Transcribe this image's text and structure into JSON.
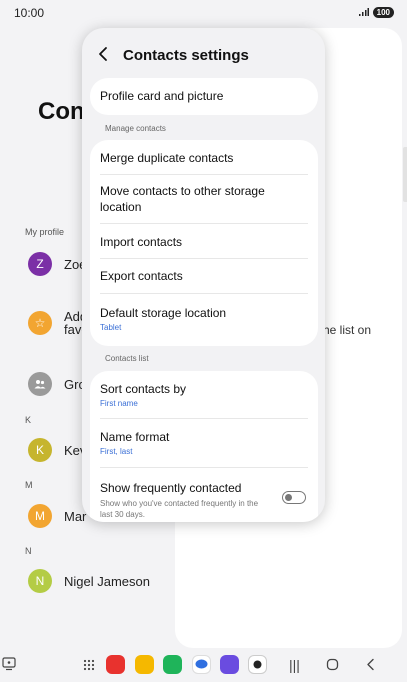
{
  "status_bar": {
    "time": "10:00",
    "battery": "100"
  },
  "background": {
    "title": "Con",
    "my_profile_label": "My profile",
    "rows": [
      {
        "initial": "Z",
        "name": "Zoe",
        "color": "#7b2fa6"
      },
      {
        "initial": "☆",
        "name": "Add",
        "name2": "fave",
        "color": "#f2a531"
      },
      {
        "initial": "",
        "name": "Gro",
        "color": "#9a9a9a"
      },
      {
        "initial": "K",
        "name": "Kev",
        "color": "#c6b52e"
      },
      {
        "initial": "M",
        "name": "Mar",
        "color": "#f2a531"
      },
      {
        "initial": "N",
        "name": "Nigel Jameson",
        "color": "#b4cc45"
      }
    ],
    "letters": {
      "k": "K",
      "m": "M",
      "n": "N"
    },
    "right_text": "he list on"
  },
  "popup": {
    "title": "Contacts settings",
    "profile_card": "Profile card and picture",
    "manage_header": "Manage contacts",
    "manage_items": {
      "merge": "Merge duplicate contacts",
      "move": "Move contacts to other storage location",
      "import": "Import contacts",
      "export": "Export contacts",
      "default_storage": "Default storage location",
      "default_storage_value": "Tablet"
    },
    "list_header": "Contacts list",
    "list_items": {
      "sort": "Sort contacts by",
      "sort_value": "First name",
      "name_format": "Name format",
      "name_format_value": "First, last",
      "frequent": "Show frequently contacted",
      "frequent_desc": "Show who you've contacted frequently in the last 30 days.",
      "frequent_on": false
    }
  },
  "colors": {
    "accent_link": "#3a6fd6"
  }
}
